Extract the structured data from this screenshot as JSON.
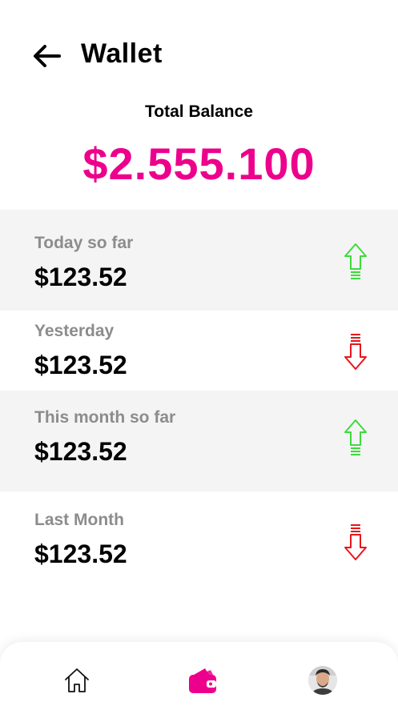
{
  "header": {
    "title": "Wallet",
    "back_icon": "arrow-left-icon"
  },
  "balance": {
    "label": "Total Balance",
    "value": "$2.555.100"
  },
  "colors": {
    "accent": "#EC008C",
    "up": "#3CDB3C",
    "down": "#E8151B",
    "row_shade": "#F4F4F4",
    "muted_text": "#8C8C8C"
  },
  "rows": [
    {
      "label": "Today so far",
      "amount": "$123.52",
      "trend": "up",
      "icon": "arrow-up-icon"
    },
    {
      "label": "Yesterday",
      "amount": "$123.52",
      "trend": "down",
      "icon": "arrow-down-icon"
    },
    {
      "label": "This month so far",
      "amount": "$123.52",
      "trend": "up",
      "icon": "arrow-up-icon"
    },
    {
      "label": "Last Month",
      "amount": "$123.52",
      "trend": "down",
      "icon": "arrow-down-icon"
    }
  ],
  "nav": {
    "items": [
      {
        "icon": "home-icon",
        "active": false
      },
      {
        "icon": "wallet-icon",
        "active": true
      },
      {
        "icon": "profile-avatar",
        "active": false
      }
    ]
  }
}
